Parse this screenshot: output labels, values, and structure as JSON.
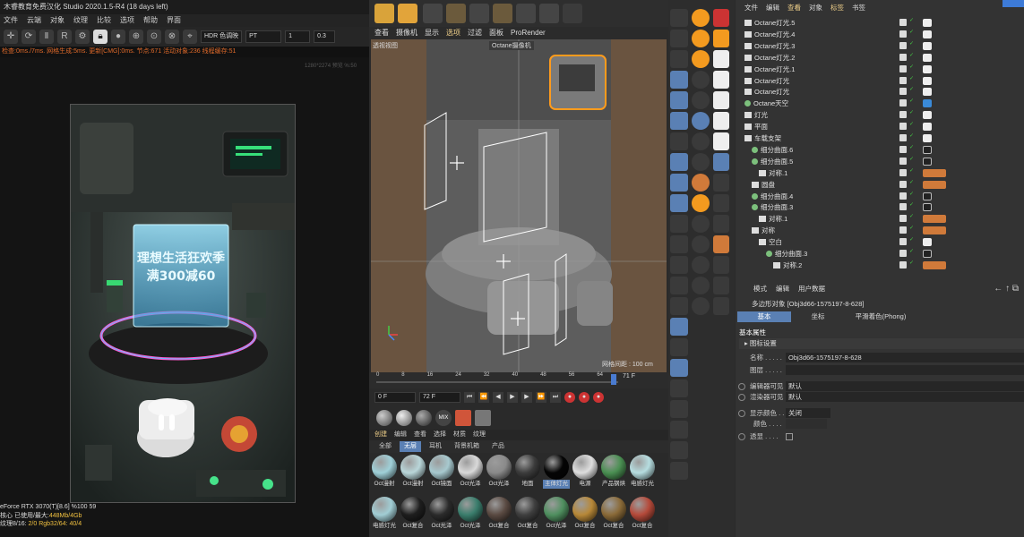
{
  "octane": {
    "title": "木睿教育免费汉化 Studio 2020.1.5-R4 (18 days left)",
    "menu": [
      "文件",
      "云端",
      "对象",
      "纹理",
      "比较",
      "选项",
      "帮助",
      "界面"
    ],
    "toolbar": {
      "mode": "HDR 色调映",
      "kernel": "PT",
      "value1": "1",
      "value2": "0.3"
    },
    "status": "检查:0ms./7ms. 网格生成:5ms. 更新[CMG]:0ms. 节点:671 活动对象:236 线程缓存:51",
    "resolution": "1280*2274 预览 %:50",
    "render_text": {
      "line1": "理想生活狂欢季",
      "line2": "满300减60"
    },
    "stats": [
      {
        "label": "eForce RTX 3070(T)[8.6]",
        "v1": "%100",
        "v2": "59"
      },
      {
        "label": "核心 已使用/最大:",
        "v1": "448Mb/4Gb",
        "v2": ""
      },
      {
        "label": "纹理8/16:",
        "v1": "2/0",
        "v2": "Rgb32/64: 40/4"
      }
    ]
  },
  "viewport": {
    "menu": [
      "查看",
      "摄像机",
      "显示",
      "选项",
      "过滤",
      "面板",
      "ProRender"
    ],
    "active_menu": "选项",
    "label": "透视视图",
    "camera_label": "Octane摄像机",
    "grid_distance": "网格间距 : 100 cm"
  },
  "timeline": {
    "ticks": [
      "0",
      "8",
      "16",
      "24",
      "32",
      "40",
      "48",
      "56",
      "64"
    ],
    "end_frame": "71 F",
    "start_field": "0 F",
    "end_field": "72 F"
  },
  "materials": {
    "menu": [
      "创建",
      "编辑",
      "查看",
      "选择",
      "材质",
      "纹理"
    ],
    "active_menu": "创建",
    "tabs": [
      "全部",
      "无层",
      "耳机",
      "背景机箱",
      "产品"
    ],
    "active_tab": "无层",
    "items": [
      {
        "label": "Oct漫射",
        "color": "#9fd0d8"
      },
      {
        "label": "Oct漫射",
        "color": "#b9d6d9"
      },
      {
        "label": "Oct镜面",
        "color": "#a7c9cf"
      },
      {
        "label": "Oct光泽",
        "color": "#d9d9d9"
      },
      {
        "label": "Oct光泽",
        "color": "#8a8a8a"
      },
      {
        "label": "地面",
        "color": "#3c3c3c"
      },
      {
        "label": "主体灯光",
        "color": "#050505"
      },
      {
        "label": "电源",
        "color": "#dedede"
      },
      {
        "label": "产品钢烘",
        "color": "#4a8f52"
      },
      {
        "label": "电感灯光",
        "color": "#b6dde0"
      },
      {
        "label": "电感灯光",
        "color": "#a1cdd4"
      },
      {
        "label": "Oct复合",
        "color": "#1e1e1e"
      },
      {
        "label": "Oct光泽",
        "color": "#2b2b2b"
      },
      {
        "label": "Oct光泽",
        "color": "#3a7d6c"
      },
      {
        "label": "Oct复合",
        "color": "#5a4a42"
      },
      {
        "label": "Oct复合",
        "color": "#3f3f3f"
      },
      {
        "label": "Oct光泽",
        "color": "#4f8f5f"
      },
      {
        "label": "Oct复合",
        "color": "#b78838"
      },
      {
        "label": "Oct复合",
        "color": "#8a6a38"
      },
      {
        "label": "Oct复合",
        "color": "#b54a3a"
      }
    ]
  },
  "object_manager": {
    "menu": [
      "文件",
      "编辑",
      "查看",
      "对象",
      "标签",
      "书签"
    ],
    "highlight": [
      "查看",
      "标签"
    ],
    "rows": [
      {
        "name": "Octane灯光.5",
        "indent": 0,
        "icon": "light"
      },
      {
        "name": "Octane灯光.4",
        "indent": 0,
        "icon": "light"
      },
      {
        "name": "Octane灯光.3",
        "indent": 0,
        "icon": "light"
      },
      {
        "name": "Octane灯光.2",
        "indent": 0,
        "icon": "light"
      },
      {
        "name": "Octane灯光.1",
        "indent": 0,
        "icon": "light"
      },
      {
        "name": "Octane灯光",
        "indent": 0,
        "icon": "light"
      },
      {
        "name": "Octane灯光",
        "indent": 0,
        "icon": "light"
      },
      {
        "name": "Octane天空",
        "indent": 0,
        "icon": "sky"
      },
      {
        "name": "灯光",
        "indent": 0,
        "icon": "null"
      },
      {
        "name": "平面",
        "indent": 0,
        "icon": "plane"
      },
      {
        "name": "车载支架",
        "indent": 0,
        "icon": "null"
      },
      {
        "name": "细分曲面.6",
        "indent": 1,
        "icon": "sds"
      },
      {
        "name": "细分曲面.5",
        "indent": 1,
        "icon": "sds"
      },
      {
        "name": "对称.1",
        "indent": 2,
        "icon": "sym"
      },
      {
        "name": "圆盘",
        "indent": 1,
        "icon": "disc"
      },
      {
        "name": "细分曲面.4",
        "indent": 1,
        "icon": "sds"
      },
      {
        "name": "细分曲面.3",
        "indent": 1,
        "icon": "sds"
      },
      {
        "name": "对称.1",
        "indent": 2,
        "icon": "sym"
      },
      {
        "name": "对称",
        "indent": 1,
        "icon": "sym"
      },
      {
        "name": "空白",
        "indent": 2,
        "icon": "null"
      },
      {
        "name": "细分曲面.3",
        "indent": 3,
        "icon": "sds"
      },
      {
        "name": "对称.2",
        "indent": 4,
        "icon": "sym"
      }
    ]
  },
  "attributes": {
    "menu": [
      "模式",
      "编辑",
      "用户数据"
    ],
    "object": "多边形对象 [Obj3d66-1575197-8-628]",
    "tabs": [
      "基本",
      "坐标",
      "平滑着色(Phong)"
    ],
    "active_tab": "基本",
    "section": "基本属性",
    "subsection": "图标设置",
    "fields": [
      {
        "label": "名称 . . . . .",
        "value": "Obj3d66-1575197-8-628"
      },
      {
        "label": "图层 . . . . .",
        "value": ""
      },
      {
        "label": "编辑器可见",
        "value": "默认"
      },
      {
        "label": "渲染器可见",
        "value": "默认"
      },
      {
        "label": "显示颜色 . .",
        "value": "关闭"
      },
      {
        "label": "颜色 . . . .",
        "value": ""
      },
      {
        "label": "透显 . . . .",
        "value": ""
      }
    ]
  },
  "colors": {
    "accent": "#5a80b4",
    "highlight": "#f0d08a",
    "status": "#e06a2a",
    "orange": "#f39a1f"
  }
}
